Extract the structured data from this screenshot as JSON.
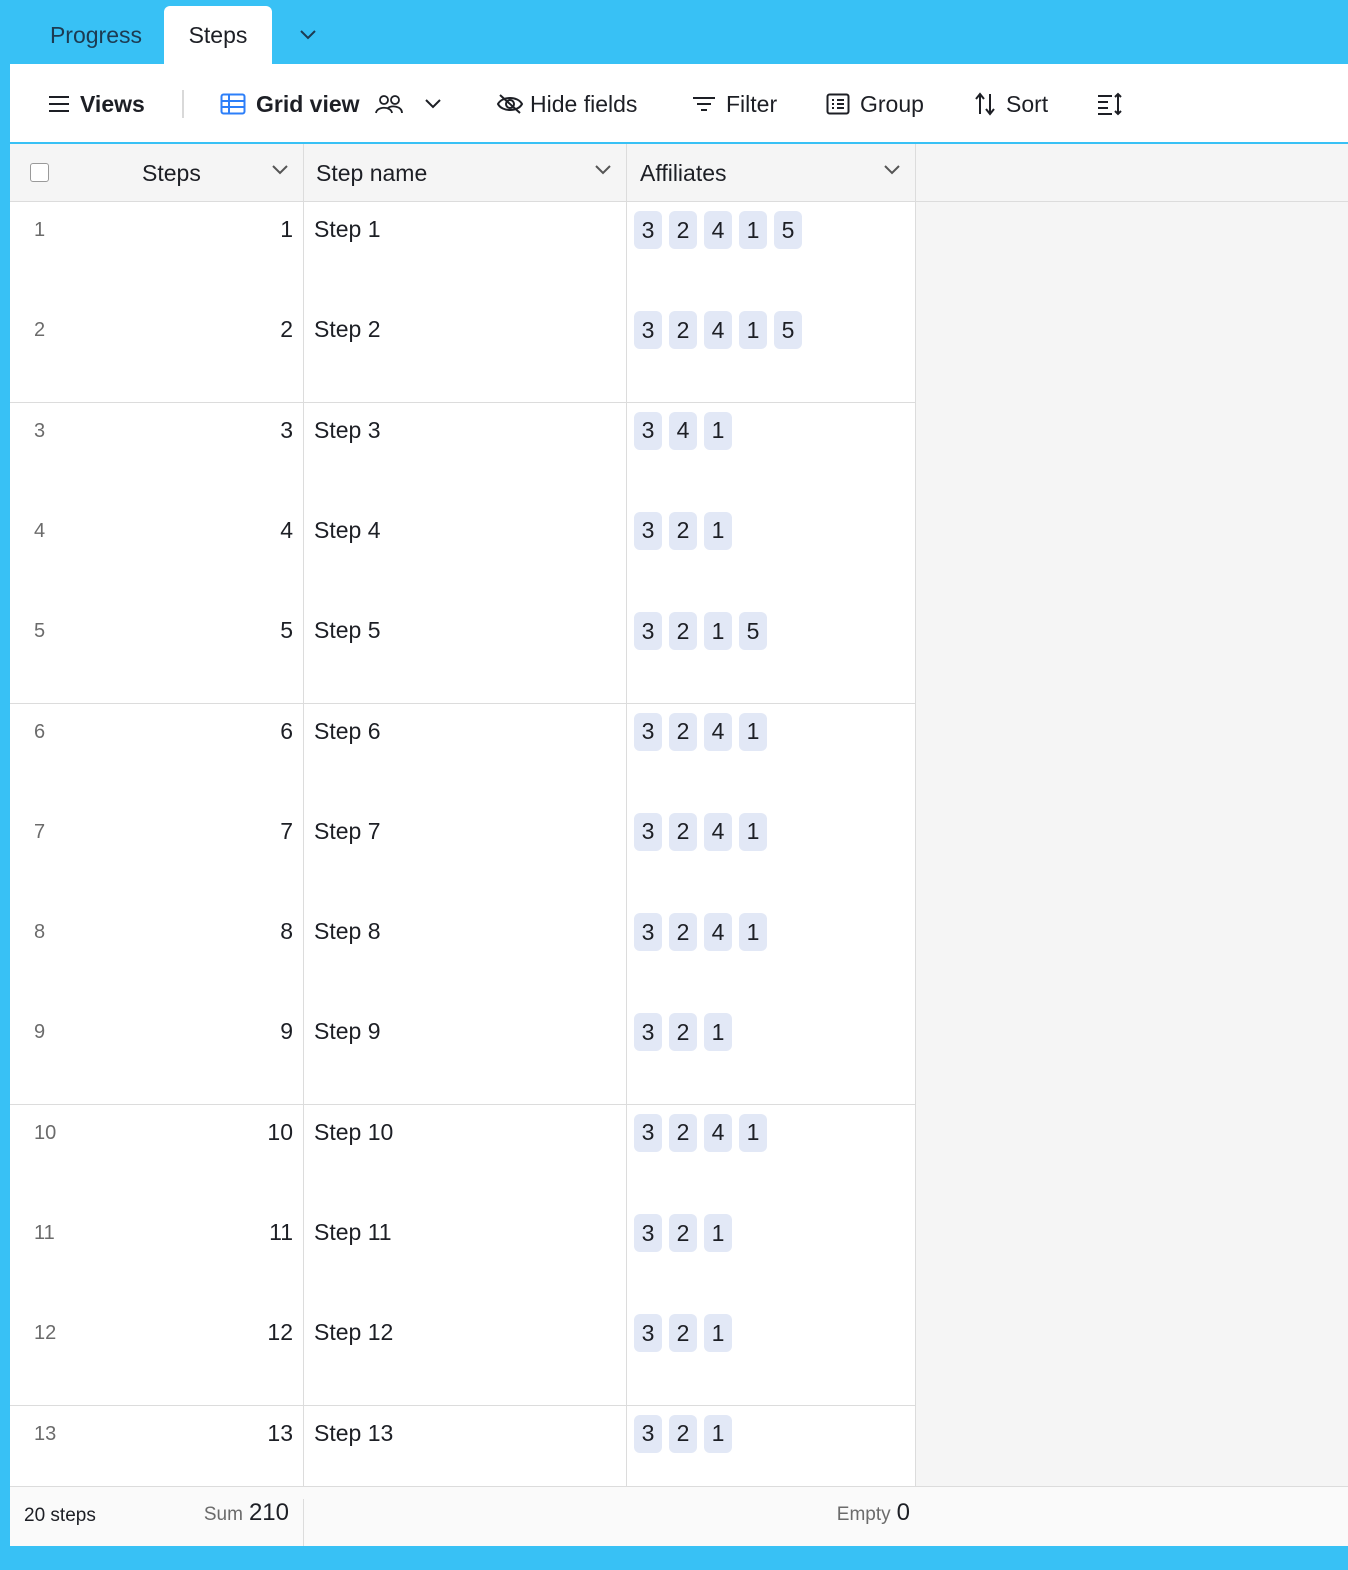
{
  "tabs": [
    {
      "label": "Progress",
      "active": false
    },
    {
      "label": "Steps",
      "active": true
    }
  ],
  "toolbar": {
    "views_label": "Views",
    "view_name": "Grid view",
    "hide_fields_label": "Hide fields",
    "filter_label": "Filter",
    "group_label": "Group",
    "sort_label": "Sort"
  },
  "columns": {
    "steps": "Steps",
    "step_name": "Step name",
    "affiliates": "Affiliates"
  },
  "rows": [
    {
      "num": "1",
      "steps": "1",
      "name": "Step 1",
      "affiliates": [
        "3",
        "2",
        "4",
        "1",
        "5"
      ]
    },
    {
      "num": "2",
      "steps": "2",
      "name": "Step 2",
      "affiliates": [
        "3",
        "2",
        "4",
        "1",
        "5"
      ]
    },
    {
      "num": "3",
      "steps": "3",
      "name": "Step 3",
      "affiliates": [
        "3",
        "4",
        "1"
      ]
    },
    {
      "num": "4",
      "steps": "4",
      "name": "Step 4",
      "affiliates": [
        "3",
        "2",
        "1"
      ]
    },
    {
      "num": "5",
      "steps": "5",
      "name": "Step 5",
      "affiliates": [
        "3",
        "2",
        "1",
        "5"
      ]
    },
    {
      "num": "6",
      "steps": "6",
      "name": "Step 6",
      "affiliates": [
        "3",
        "2",
        "4",
        "1"
      ]
    },
    {
      "num": "7",
      "steps": "7",
      "name": "Step 7",
      "affiliates": [
        "3",
        "2",
        "4",
        "1"
      ]
    },
    {
      "num": "8",
      "steps": "8",
      "name": "Step 8",
      "affiliates": [
        "3",
        "2",
        "4",
        "1"
      ]
    },
    {
      "num": "9",
      "steps": "9",
      "name": "Step 9",
      "affiliates": [
        "3",
        "2",
        "1"
      ]
    },
    {
      "num": "10",
      "steps": "10",
      "name": "Step 10",
      "affiliates": [
        "3",
        "2",
        "4",
        "1"
      ]
    },
    {
      "num": "11",
      "steps": "11",
      "name": "Step 11",
      "affiliates": [
        "3",
        "2",
        "1"
      ]
    },
    {
      "num": "12",
      "steps": "12",
      "name": "Step 12",
      "affiliates": [
        "3",
        "2",
        "1"
      ]
    },
    {
      "num": "13",
      "steps": "13",
      "name": "Step 13",
      "affiliates": [
        "3",
        "2",
        "1"
      ]
    }
  ],
  "footer": {
    "record_count": "20 steps",
    "sum_label": "Sum",
    "sum_value": "210",
    "empty_label": "Empty",
    "empty_value": "0"
  },
  "colors": {
    "chrome": "#38c1f5",
    "chip": "#e2e8f6",
    "grid_icon": "#2d7ff9"
  },
  "icons": {
    "views": "hamburger-icon",
    "view_type": "grid-icon",
    "collaborators": "people-icon",
    "hide_fields": "eye-slash-icon",
    "filter": "filter-lines-icon",
    "group": "group-list-icon",
    "sort": "sort-arrows-icon",
    "row_height": "row-height-icon",
    "column_menu": "chevron-down-icon"
  }
}
